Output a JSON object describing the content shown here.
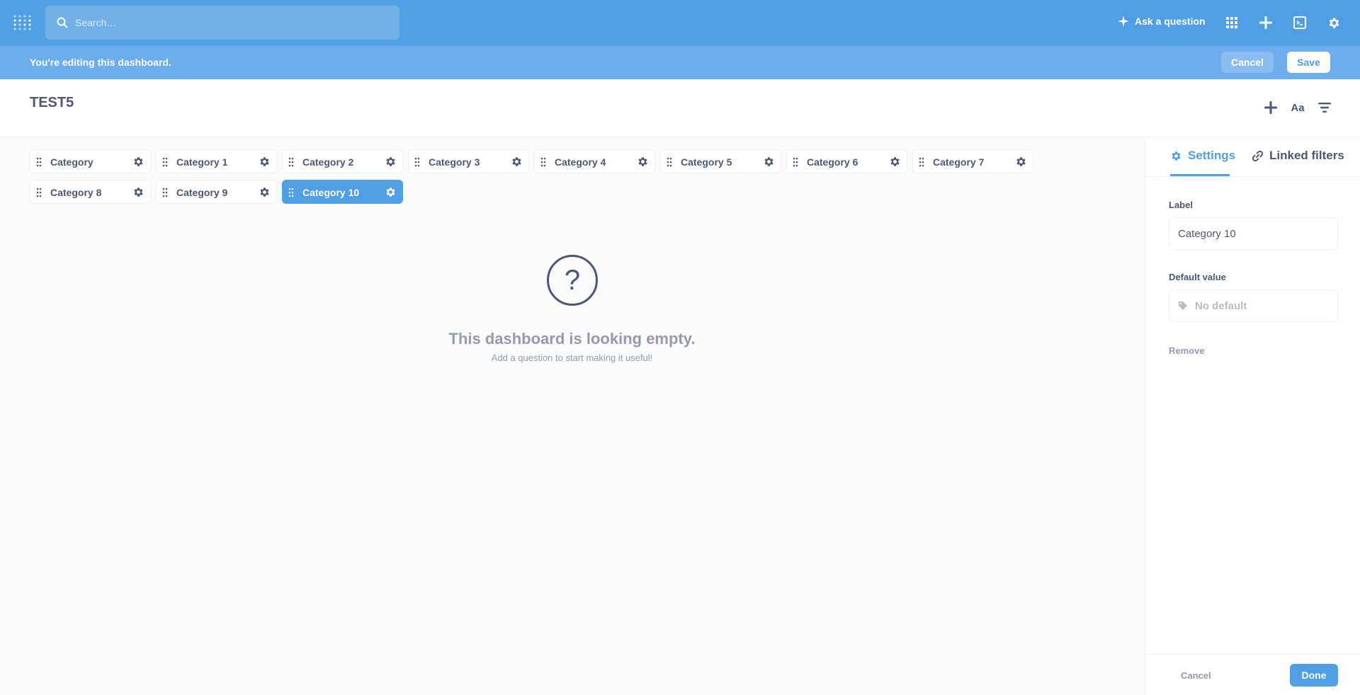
{
  "topnav": {
    "search_placeholder": "Search…",
    "ask_label": "Ask a question",
    "icons": [
      "logo-icon",
      "search-icon",
      "sparkle-icon",
      "grid-icon",
      "plus-icon",
      "terminal-icon",
      "gear-icon"
    ]
  },
  "editbar": {
    "message": "You're editing this dashboard.",
    "cancel_label": "Cancel",
    "save_label": "Save"
  },
  "header": {
    "title": "TEST5",
    "text_tool_label": "Aa"
  },
  "filters": [
    {
      "label": "Category",
      "active": false
    },
    {
      "label": "Category 1",
      "active": false
    },
    {
      "label": "Category 2",
      "active": false
    },
    {
      "label": "Category 3",
      "active": false
    },
    {
      "label": "Category 4",
      "active": false
    },
    {
      "label": "Category 5",
      "active": false
    },
    {
      "label": "Category 6",
      "active": false
    },
    {
      "label": "Category 7",
      "active": false
    },
    {
      "label": "Category 8",
      "active": false
    },
    {
      "label": "Category 9",
      "active": false
    },
    {
      "label": "Category 10",
      "active": true
    }
  ],
  "empty_state": {
    "heading": "This dashboard is looking empty.",
    "subtext": "Add a question to start making it useful!"
  },
  "sidebar": {
    "tabs": [
      {
        "label": "Settings",
        "active": true
      },
      {
        "label": "Linked filters",
        "active": false
      }
    ],
    "label_field": {
      "label": "Label",
      "value": "Category 10"
    },
    "default_field": {
      "label": "Default value",
      "placeholder": "No default"
    },
    "remove_label": "Remove",
    "cancel_label": "Cancel",
    "done_label": "Done"
  },
  "colors": {
    "brand": "#509ee3",
    "editbar": "#6dadec",
    "text_dark": "#4c5773",
    "text_light": "#949aab"
  }
}
